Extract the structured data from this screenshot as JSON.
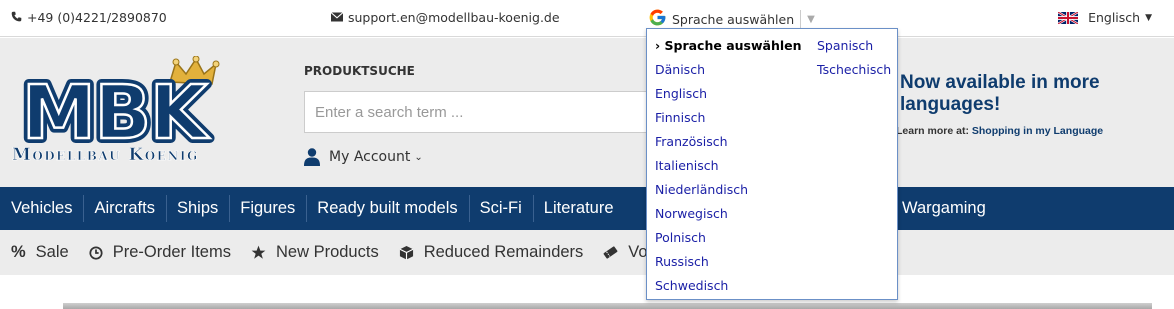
{
  "topbar": {
    "phone": "+49 (0)4221/2890870",
    "email": "support.en@modellbau-koenig.de",
    "translate_label": "Sprache auswählen",
    "current_language": "Englisch"
  },
  "header": {
    "logo_text_main": "MBK",
    "logo_text_sub": "Modellbau Koenig",
    "search_label": "PRODUKTSUCHE",
    "search_placeholder": "Enter a search term ...",
    "account_label": "My Account",
    "promo_title": "Now available in more languages!",
    "promo_link_prefix": "Learn more at:",
    "promo_link_text": "Shopping in my Language"
  },
  "main_nav": [
    "Vehicles",
    "Aircrafts",
    "Ships",
    "Figures",
    "Ready built models",
    "Sci-Fi",
    "Literature"
  ],
  "main_nav_hidden_right": "Wargaming",
  "sub_nav": [
    {
      "icon": "percent-icon",
      "label": "Sale"
    },
    {
      "icon": "clock-icon",
      "label": "Pre-Order Items"
    },
    {
      "icon": "star-icon",
      "label": "New Products"
    },
    {
      "icon": "box-icon",
      "label": "Reduced Remainders"
    },
    {
      "icon": "voucher-icon",
      "label": "Vou"
    }
  ],
  "language_dropdown": {
    "column1": [
      "› Sprache auswählen",
      "Dänisch",
      "Englisch",
      "Finnisch",
      "Französisch",
      "Italienisch",
      "Niederländisch",
      "Norwegisch",
      "Polnisch",
      "Russisch",
      "Schwedisch"
    ],
    "column2": [
      "Spanisch",
      "Tschechisch"
    ]
  },
  "colors": {
    "brand_navy": "#0f3c6e",
    "header_bg": "#ececec",
    "dropdown_link": "#1a1fa6",
    "crown_gold": "#e2b13c"
  }
}
